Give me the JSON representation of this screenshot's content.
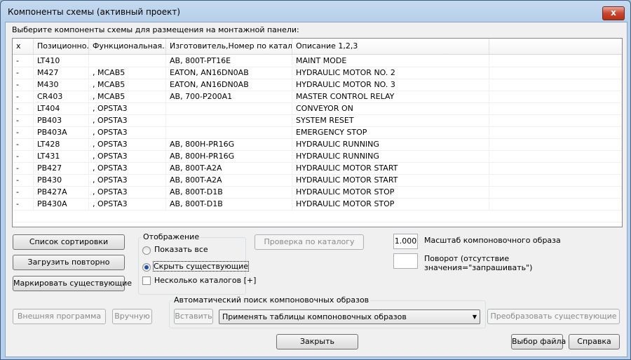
{
  "window": {
    "title": "Компоненты схемы (активный проект)",
    "close_glyph": "x"
  },
  "prompt": "Выберите компоненты схемы для размещения на монтажной панели:",
  "table": {
    "headers": [
      "x",
      "Позиционно...",
      "Функциональная...",
      "Изготовитель,Номер по катал...",
      "Описание 1,2,3",
      ""
    ],
    "rows": [
      [
        "-",
        "LT410",
        "",
        "AB, 800T-PT16E",
        "MAINT MODE"
      ],
      [
        "-",
        "M427",
        ", MCAB5",
        "EATON, AN16DN0AB",
        "HYDRAULIC MOTOR NO. 2"
      ],
      [
        "-",
        "M430",
        ", MCAB5",
        "EATON, AN16DN0AB",
        "HYDRAULIC MOTOR NO. 3"
      ],
      [
        "-",
        "CR403",
        ", MCAB5",
        "AB, 700-P200A1",
        "MASTER CONTROL RELAY"
      ],
      [
        "-",
        "LT404",
        ", OPSTA3",
        "",
        "CONVEYOR ON"
      ],
      [
        "-",
        "PB403",
        ", OPSTA3",
        "",
        "SYSTEM RESET"
      ],
      [
        "-",
        "PB403A",
        ", OPSTA3",
        "",
        "EMERGENCY STOP"
      ],
      [
        "-",
        "LT428",
        ", OPSTA3",
        "AB, 800H-PR16G",
        "HYDRAULIC RUNNING"
      ],
      [
        "-",
        "LT431",
        ", OPSTA3",
        "AB, 800H-PR16G",
        "HYDRAULIC RUNNING"
      ],
      [
        "-",
        "PB427",
        ", OPSTA3",
        "AB, 800T-A2A",
        "HYDRAULIC MOTOR START"
      ],
      [
        "-",
        "PB430",
        ", OPSTA3",
        "AB, 800T-A2A",
        "HYDRAULIC MOTOR START"
      ],
      [
        "-",
        "PB427A",
        ", OPSTA3",
        "AB, 800T-D1B",
        "HYDRAULIC MOTOR STOP"
      ],
      [
        "-",
        "PB430A",
        ", OPSTA3",
        "AB, 800T-D1B",
        "HYDRAULIC MOTOR STOP"
      ]
    ]
  },
  "buttons": {
    "sort_list": "Список сортировки",
    "reload": "Загрузить повторно",
    "mark_existing": "Маркировать существующие",
    "catalog_check": "Проверка по каталогу",
    "external_program": "Внешняя программа",
    "manual": "Вручную",
    "insert": "Вставить",
    "convert_existing": "Преобразовать существующие",
    "close": "Закрыть",
    "select_file": "Выбор файла",
    "help": "Справка"
  },
  "display_group": {
    "label": "Отображение",
    "show_all": "Показать все",
    "hide_existing": "Скрыть существующие",
    "multiple_catalogs": "Несколько каталогов [+]",
    "selected": "hide_existing",
    "multiple_catalogs_checked": false
  },
  "scale": {
    "value": "1.000",
    "label": "Масштаб компоновочного образа"
  },
  "rotation": {
    "value": "",
    "label_line1": "Поворот (отсутствие",
    "label_line2": "значения=\"запрашивать\")"
  },
  "auto_search": {
    "label": "Автоматический поиск компоновочных образов",
    "dropdown_value": "Применять таблицы компоновочных образов"
  }
}
